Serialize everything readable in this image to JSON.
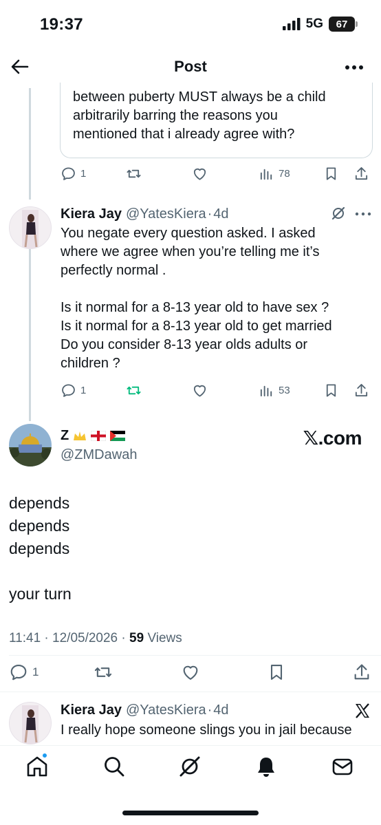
{
  "status_bar": {
    "time": "19:37",
    "network": "5G",
    "battery": "67"
  },
  "header": {
    "title": "Post"
  },
  "quoted_reply": {
    "text": "between puberty MUST always be a child\narbitrarily barring the reasons you\nmentioned that i already agree with?",
    "actions": {
      "replies": "1",
      "views": "78"
    }
  },
  "reply_1": {
    "name": "Kiera Jay",
    "handle": "@YatesKiera",
    "sep": "·",
    "time": "4d",
    "text": "You negate every question asked. I asked\nwhere we agree when you’re telling me it’s\nperfectly normal .\n\nIs it normal for a 8-13 year old to have sex ?\nIs it normal for a 8-13 year old to get married\nDo you consider 8-13 year olds adults or\nchildren ?",
    "actions": {
      "replies": "1",
      "views": "53"
    }
  },
  "main_post": {
    "name": "Z",
    "name_emojis": [
      "crown",
      "england-flag",
      "palestine-flag"
    ],
    "handle": "@ZMDawah",
    "watermark": "𝕏.com",
    "text": "depends\ndepends\ndepends\n\nyour turn",
    "time": "11:41",
    "sep1": "·",
    "date": "12/05/2026",
    "sep2": "·",
    "views": "59",
    "views_label": "Views",
    "actions": {
      "replies": "1"
    }
  },
  "reply_2": {
    "name": "Kiera Jay",
    "handle": "@YatesKiera",
    "sep": "·",
    "time": "4d",
    "text": "I really hope someone slings you in jail because"
  },
  "bottom_nav": [
    "home-icon",
    "search-icon",
    "grok-icon",
    "notifications-icon",
    "messages-icon"
  ],
  "colors": {
    "accent": "#1d9bf0",
    "retweet_active": "#00ba7c",
    "secondary_text": "#536471",
    "border": "#cfd9de"
  }
}
